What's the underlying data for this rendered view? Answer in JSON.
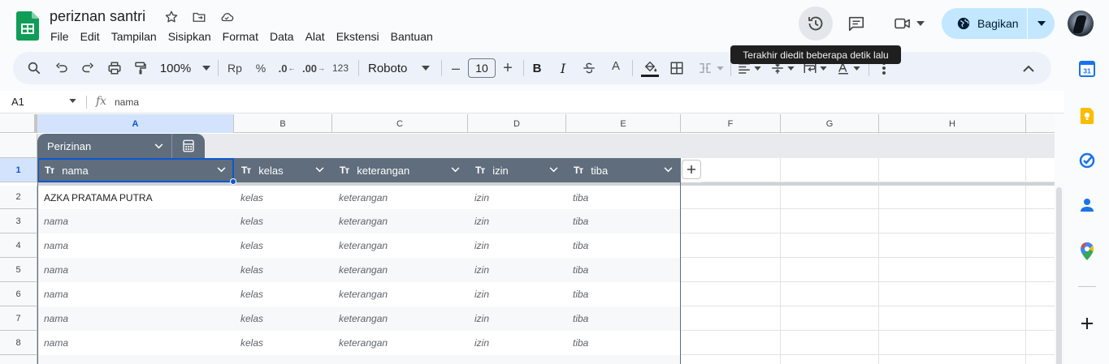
{
  "document": {
    "title": "periznan santri"
  },
  "menu": [
    "File",
    "Edit",
    "Tampilan",
    "Sisipkan",
    "Format",
    "Data",
    "Alat",
    "Ekstensi",
    "Bantuan"
  ],
  "header": {
    "share_label": "Bagikan",
    "tooltip": "Terakhir diedit beberapa detik lalu"
  },
  "toolbar": {
    "zoom": "100%",
    "currency": "Rp",
    "percent": "%",
    "decrease_decimal": ".0",
    "increase_decimal": ".00",
    "format_123": "123",
    "font": "Roboto",
    "font_size": "10",
    "minus": "–",
    "plus": "+",
    "bold": "B",
    "italic": "I",
    "text_color": "A"
  },
  "formula_bar": {
    "cell_ref": "A1",
    "fx": "fx",
    "value": "nama"
  },
  "columns": [
    "A",
    "B",
    "C",
    "D",
    "E",
    "F",
    "G",
    "H"
  ],
  "rows": [
    "1",
    "2",
    "3",
    "4",
    "5",
    "6",
    "7",
    "8"
  ],
  "table": {
    "name": "Perizinan",
    "type_icon": "Tт",
    "headers": [
      "nama",
      "kelas",
      "keterangan",
      "izin",
      "tiba"
    ],
    "rows": [
      [
        "AZKA PRATAMA PUTRA",
        "kelas",
        "keterangan",
        "izin",
        "tiba"
      ],
      [
        "nama",
        "kelas",
        "keterangan",
        "izin",
        "tiba"
      ],
      [
        "nama",
        "kelas",
        "keterangan",
        "izin",
        "tiba"
      ],
      [
        "nama",
        "kelas",
        "keterangan",
        "izin",
        "tiba"
      ],
      [
        "nama",
        "kelas",
        "keterangan",
        "izin",
        "tiba"
      ],
      [
        "nama",
        "kelas",
        "keterangan",
        "izin",
        "tiba"
      ],
      [
        "nama",
        "kelas",
        "keterangan",
        "izin",
        "tiba"
      ]
    ]
  },
  "side_panel": {
    "calendar_day": "31"
  }
}
